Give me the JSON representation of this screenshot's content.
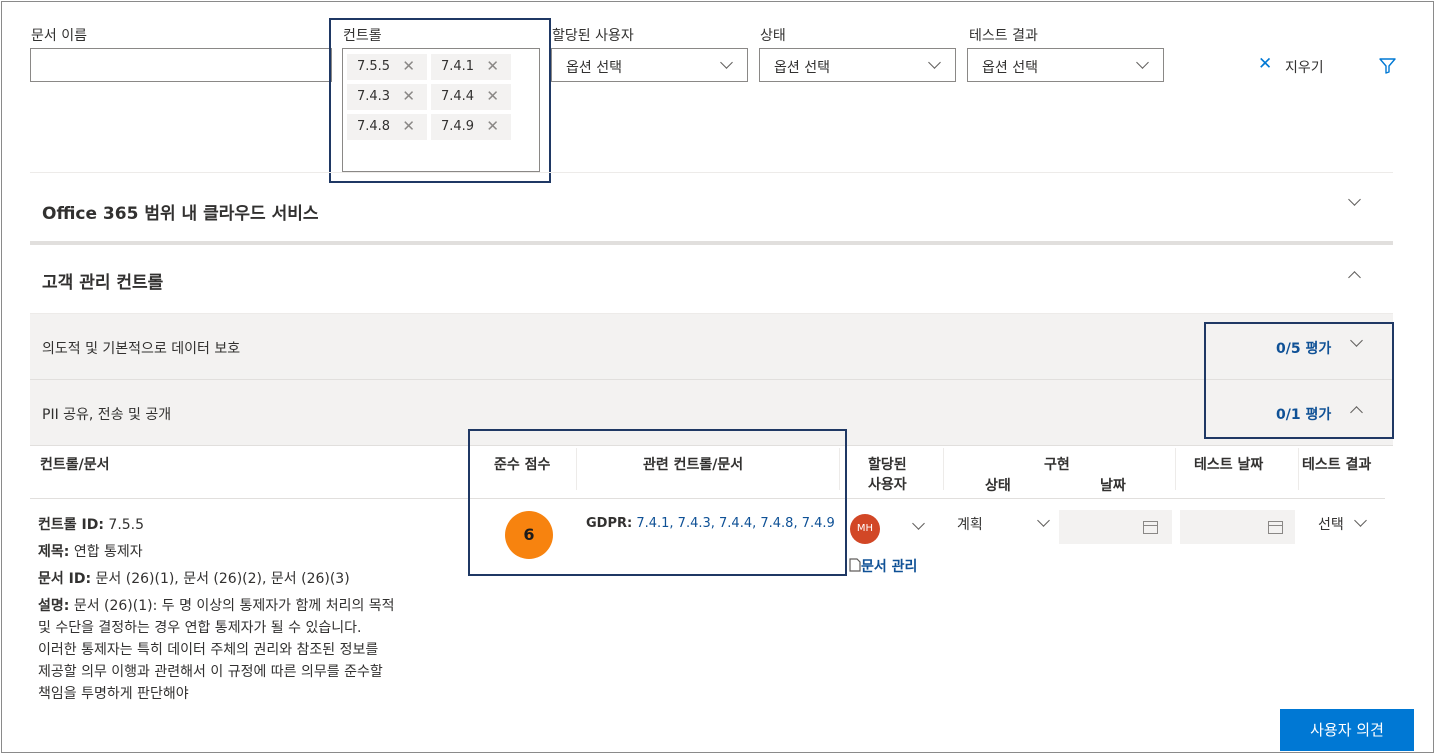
{
  "filters": {
    "doc_name": {
      "label": "문서 이름",
      "value": ""
    },
    "control": {
      "label": "컨트롤",
      "tags": [
        "7.5.5",
        "7.4.1",
        "7.4.3",
        "7.4.4",
        "7.4.8",
        "7.4.9"
      ]
    },
    "assigned_user": {
      "label": "할당된 사용자",
      "value": "옵션 선택"
    },
    "status": {
      "label": "상태",
      "value": "옵션 선택"
    },
    "test_result": {
      "label": "테스트 결과",
      "value": "옵션 선택"
    },
    "clear_label": "지우기"
  },
  "sections": {
    "cloud": "Office 365 범위 내 클라우드 서비스",
    "customer": "고객 관리 컨트롤",
    "group1": {
      "title": "의도적 및 기본적으로 데이터 보호",
      "assessments": "0/5 평가"
    },
    "group2": {
      "title": "PII 공유, 전송 및 공개",
      "assessments": "0/1 평가"
    }
  },
  "table": {
    "headers": {
      "control_doc": "컨트롤/문서",
      "score": "준수 점수",
      "related": "관련 컨트롤/문서",
      "assigned_line1": "할당된",
      "assigned_line2": "사용자",
      "impl": "구현",
      "impl_status": "상태",
      "impl_date": "날짜",
      "test_date": "테스트 날짜",
      "test_result": "테스트 결과"
    },
    "row": {
      "control_id_label": "컨트롤 ID:",
      "control_id": "7.5.5",
      "title_label": "제목:",
      "title": "연합 통제자",
      "doc_id_label": "문서 ID:",
      "doc_id": "문서 (26)(1), 문서 (26)(2), 문서 (26)(3)",
      "desc_label": "설명:",
      "desc_lines": [
        "문서 (26)(1): 두 명 이상의 통제자가 함께 처리의 목적",
        "및 수단을 결정하는 경우 연합 통제자가 될 수 있습니다.",
        "이러한 통제자는 특히 데이터 주체의 권리와 참조된 정보를",
        "제공할 의무 이행과 관련해서 이 규정에 따른 의무를 준수할",
        "책임을 투명하게 판단해야"
      ],
      "score": "6",
      "related_prefix": "GDPR:",
      "related_links": "7.4.1, 7.4.3, 7.4.4, 7.4.8, 7.4.9",
      "avatar": "MH",
      "manage_docs": "문서 관리",
      "impl_status": "계획",
      "test_result": "선택"
    }
  },
  "feedback_button": "사용자 의견",
  "colors": {
    "accent": "#0078d4",
    "score_badge": "#f7830f",
    "highlight_border": "#1f3864",
    "link": "#0f5196"
  }
}
